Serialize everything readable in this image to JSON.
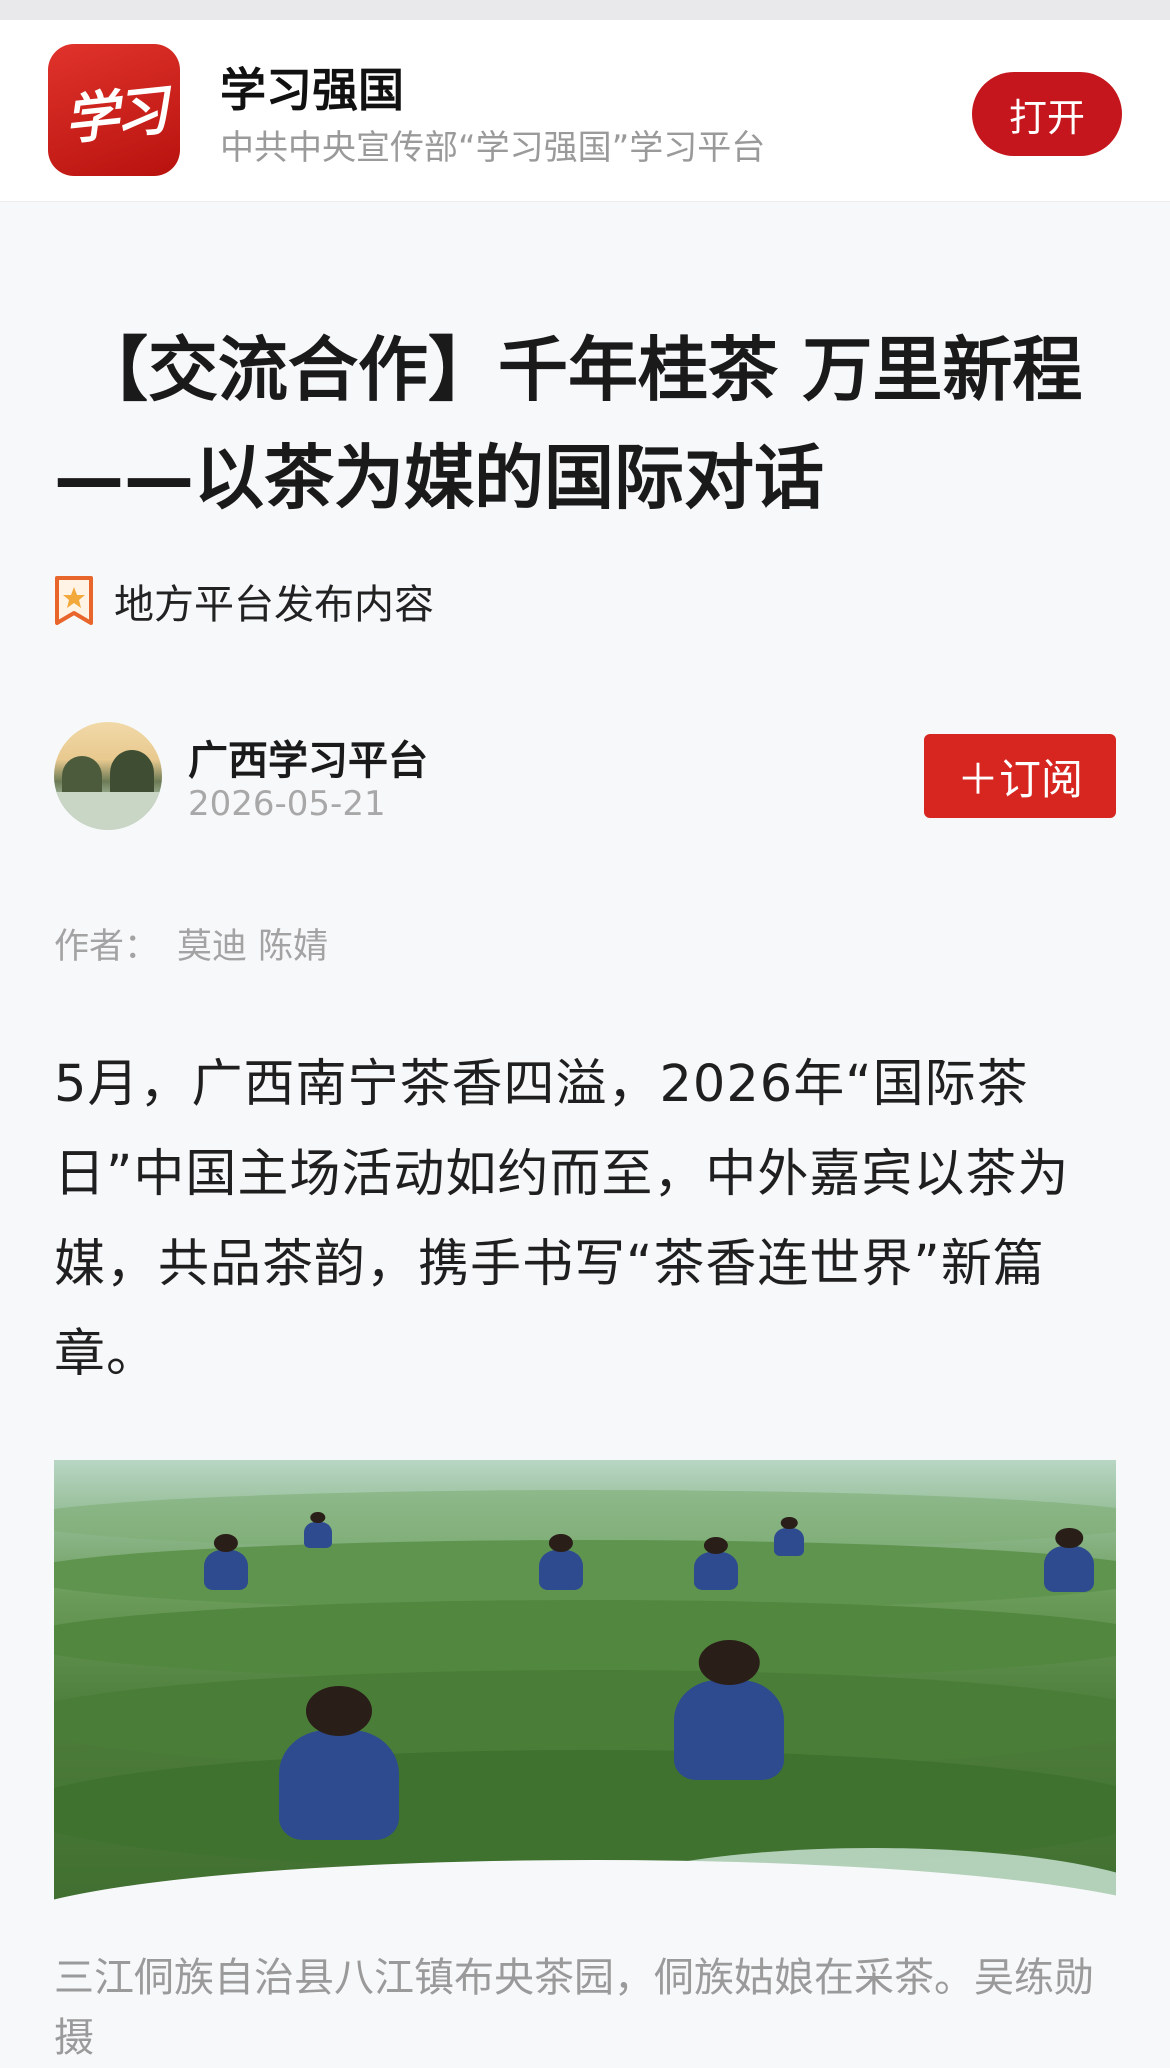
{
  "app_banner": {
    "logo_text": "学习",
    "name": "学习强国",
    "description": "中共中央宣传部“学习强国”学习平台",
    "open_button": "打开"
  },
  "article": {
    "title_line1": "【交流合作】千年桂茶 万里新程",
    "title_line2": "——以茶为媒的国际对话",
    "source_tag": "地方平台发布内容",
    "publisher": "广西学习平台",
    "date": "2026-05-21",
    "subscribe_button": "＋订阅",
    "author_label": "作者：",
    "author_names": "莫迪 陈婧",
    "body": "5月，广西南宁茶香四溢，2026年“国际茶日”中国主场活动如约而至，中外嘉宾以茶为媒，共品茶韵，携手书写“茶香连世界”新篇章。",
    "image_caption": "三江侗族自治县八江镇布央茶园，侗族姑娘在采茶。吴练勋 摄"
  },
  "colors": {
    "brand_red": "#c4161c",
    "subscribe_red": "#d6261f",
    "muted_text": "#9a9a9a"
  }
}
